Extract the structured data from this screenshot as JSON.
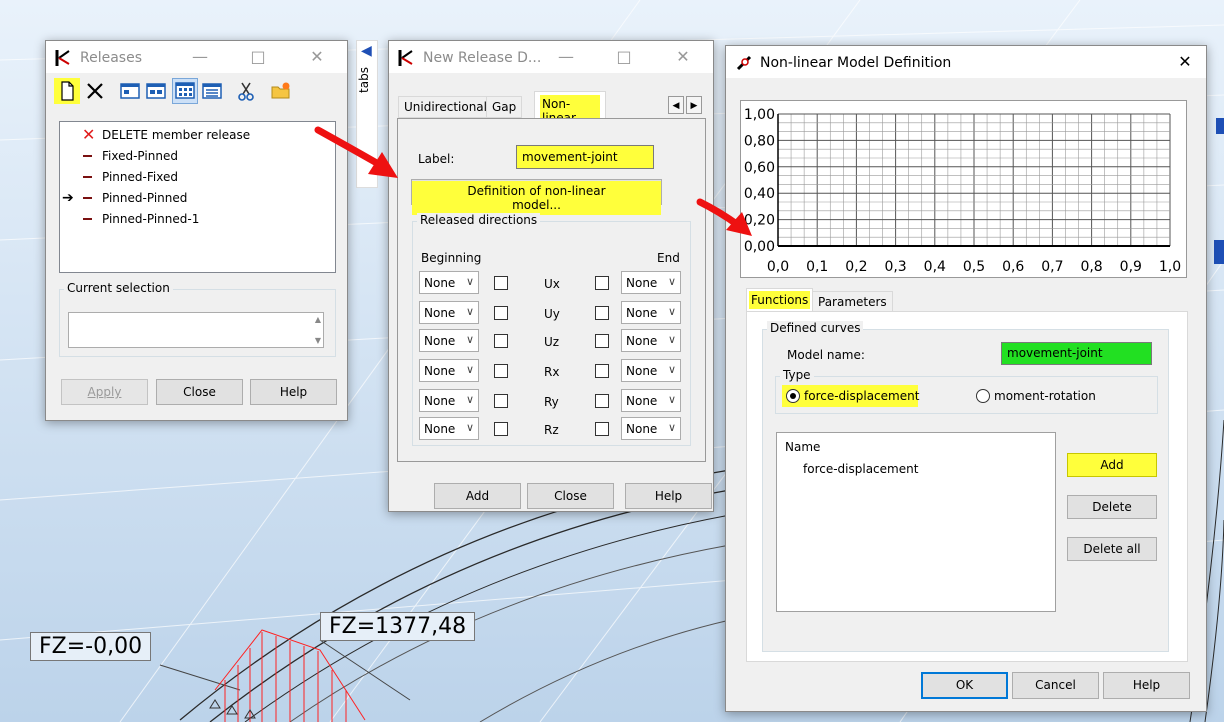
{
  "colors": {
    "highlight": "#ffff3b",
    "model_name_bg": "#22e022",
    "arrow_red": "#ee1111",
    "accent_blue": "#0078d7"
  },
  "background": {
    "labels": [
      "FZ=-0,00",
      "FZ=1377,48"
    ],
    "tabs_label": "tabs"
  },
  "releases": {
    "title": "Releases",
    "toolbar_icons": [
      "new-icon",
      "delete-x-icon",
      "window-icon-1",
      "window-icon-2",
      "grid-view-icon",
      "list-view-icon",
      "scissors-icon",
      "folder-star-icon"
    ],
    "items": [
      {
        "label": "DELETE member release",
        "kind": "delete"
      },
      {
        "label": "Fixed-Pinned",
        "kind": "line"
      },
      {
        "label": "Pinned-Fixed",
        "kind": "line"
      },
      {
        "label": "Pinned-Pinned",
        "kind": "line",
        "current": true
      },
      {
        "label": "Pinned-Pinned-1",
        "kind": "line"
      }
    ],
    "current_selection_label": "Current selection",
    "current_selection_value": "",
    "buttons": {
      "apply": "Apply",
      "close": "Close",
      "help": "Help"
    }
  },
  "new_release": {
    "title": "New Release D...",
    "tabs": [
      "Unidirectional",
      "Gap",
      "Non-linear"
    ],
    "active_tab": "Non-linear",
    "label_caption": "Label:",
    "label_value": "movement-joint",
    "definition_button": "Definition of non-linear model...",
    "released_directions": "Released directions",
    "beginning": "Beginning",
    "end": "End",
    "rows": [
      {
        "dir": "Ux",
        "begin": "None",
        "end": "None"
      },
      {
        "dir": "Uy",
        "begin": "None",
        "end": "None"
      },
      {
        "dir": "Uz",
        "begin": "None",
        "end": "None"
      },
      {
        "dir": "Rx",
        "begin": "None",
        "end": "None"
      },
      {
        "dir": "Ry",
        "begin": "None",
        "end": "None"
      },
      {
        "dir": "Rz",
        "begin": "None",
        "end": "None"
      }
    ],
    "buttons": {
      "add": "Add",
      "close": "Close",
      "help": "Help"
    }
  },
  "nonlinear": {
    "title": "Non-linear Model Definition",
    "y_ticks": [
      "1,00",
      "0,80",
      "0,60",
      "0,40",
      "0,20",
      "0,00"
    ],
    "x_ticks": [
      "0,0",
      "0,1",
      "0,2",
      "0,3",
      "0,4",
      "0,5",
      "0,6",
      "0,7",
      "0,8",
      "0,9",
      "1,0"
    ],
    "tabs": [
      "Functions",
      "Parameters"
    ],
    "defined_curves": "Defined curves",
    "model_name_label": "Model name:",
    "model_name_value": "movement-joint",
    "type_label": "Type",
    "type_options": [
      "force-displacement",
      "moment-rotation"
    ],
    "type_selected": "force-displacement",
    "list_header": "Name",
    "list_items": [
      "force-displacement"
    ],
    "side_buttons": {
      "add": "Add",
      "delete": "Delete",
      "delete_all": "Delete all"
    },
    "buttons": {
      "ok": "OK",
      "cancel": "Cancel",
      "help": "Help"
    }
  }
}
